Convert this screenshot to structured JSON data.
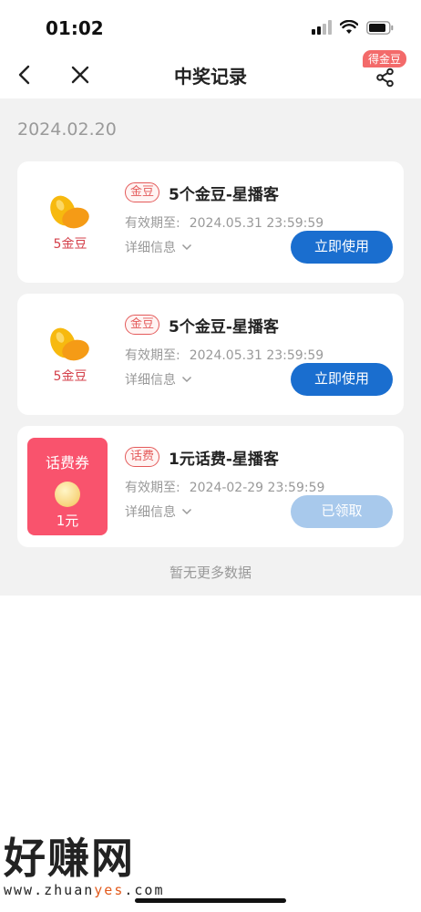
{
  "status": {
    "time": "01:02"
  },
  "nav": {
    "title": "中奖记录",
    "share_badge": "得金豆"
  },
  "date_group": "2024.02.20",
  "records": [
    {
      "icon": "gold-beans-icon",
      "icon_caption": "5金豆",
      "tag": "金豆",
      "title": "5个金豆-星播客",
      "valid_label": "有效期至:",
      "valid_date": "2024.05.31 23:59:59",
      "detail": "详细信息",
      "button": "立即使用",
      "button_state": "active"
    },
    {
      "icon": "gold-beans-icon",
      "icon_caption": "5金豆",
      "tag": "金豆",
      "title": "5个金豆-星播客",
      "valid_label": "有效期至:",
      "valid_date": "2024.05.31 23:59:59",
      "detail": "详细信息",
      "button": "立即使用",
      "button_state": "active"
    },
    {
      "icon": "phone-bill-coupon-icon",
      "coupon_title": "话费券",
      "coupon_amount": "1元",
      "tag": "话费",
      "title": "1元话费-星播客",
      "valid_label": "有效期至:",
      "valid_date": "2024-02-29 23:59:59",
      "detail": "详细信息",
      "button": "已领取",
      "button_state": "disabled"
    }
  ],
  "footer": {
    "no_more": "暂无更多数据"
  },
  "watermark": {
    "text": "好赚网",
    "url_a": "www.zhuan",
    "url_b": "yes",
    "url_c": ".com"
  },
  "colors": {
    "primary_button": "#1a6ecf",
    "disabled_button": "#a8c9ec",
    "tag_red": "#e45a5a",
    "coupon_red": "#f9536d"
  }
}
